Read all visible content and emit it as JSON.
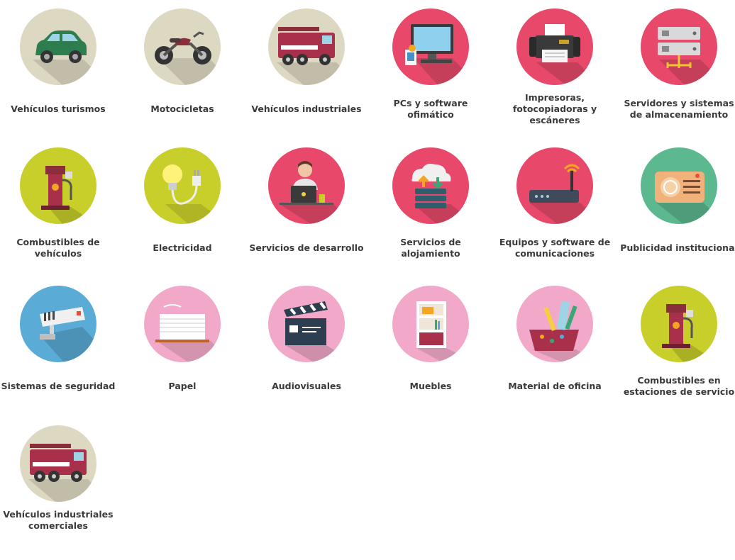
{
  "categories": [
    {
      "label": "Vehículos turismos",
      "icon": "car-icon",
      "bg": "#ddd8c1"
    },
    {
      "label": "Motocicletas",
      "icon": "motorcycle-icon",
      "bg": "#ddd8c1"
    },
    {
      "label": "Vehículos industriales",
      "icon": "fire-truck-icon",
      "bg": "#ddd8c1"
    },
    {
      "label": "PCs y software ofimático",
      "icon": "desktop-computer-icon",
      "bg": "#e8496a"
    },
    {
      "label": "Impresoras, fotocopiadoras y escáneres",
      "icon": "printer-icon",
      "bg": "#e8496a"
    },
    {
      "label": "Servidores y sistemas de almacenamiento",
      "icon": "server-icon",
      "bg": "#e8496a"
    },
    {
      "label": "Combustibles de vehículos",
      "icon": "fuel-pump-icon",
      "bg": "#c8cf2a"
    },
    {
      "label": "Electricidad",
      "icon": "light-bulb-plug-icon",
      "bg": "#c8cf2a"
    },
    {
      "label": "Servicios de desarrollo",
      "icon": "developer-icon",
      "bg": "#e8496a"
    },
    {
      "label": "Servicios de alojamiento",
      "icon": "cloud-hosting-icon",
      "bg": "#e8496a"
    },
    {
      "label": "Equipos y software de comunicaciones",
      "icon": "router-icon",
      "bg": "#e8496a"
    },
    {
      "label": "Publicidad institucional",
      "icon": "radio-icon",
      "bg": "#5cb88f"
    },
    {
      "label": "Sistemas de seguridad",
      "icon": "security-camera-icon",
      "bg": "#5aacd6"
    },
    {
      "label": "Papel",
      "icon": "paper-icon",
      "bg": "#f2a9c9"
    },
    {
      "label": "Audiovisuales",
      "icon": "clapperboard-icon",
      "bg": "#f2a9c9"
    },
    {
      "label": "Muebles",
      "icon": "bookshelf-icon",
      "bg": "#f2a9c9"
    },
    {
      "label": "Material de oficina",
      "icon": "office-supplies-icon",
      "bg": "#f2a9c9"
    },
    {
      "label": "Combustibles en estaciones de servicio",
      "icon": "fuel-pump-icon",
      "bg": "#c8cf2a"
    },
    {
      "label": "Vehículos industriales comerciales",
      "icon": "fire-truck-icon",
      "bg": "#ddd8c1"
    }
  ]
}
